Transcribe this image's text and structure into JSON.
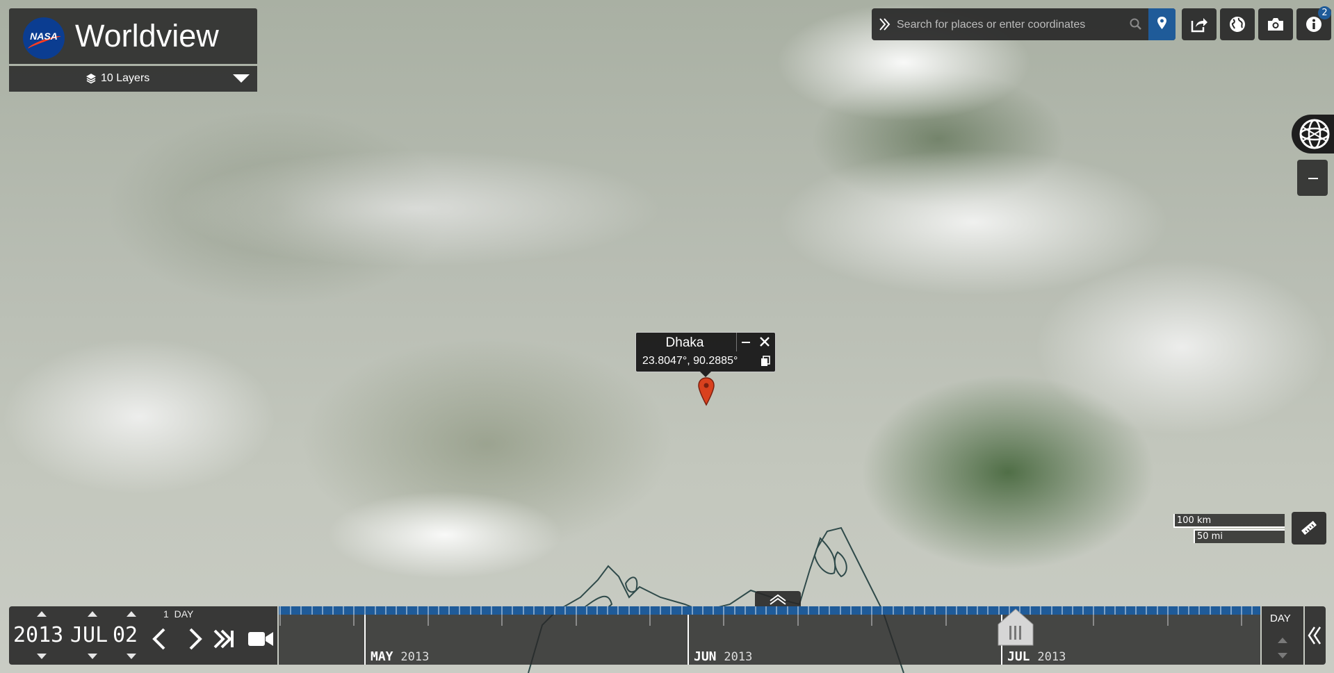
{
  "app": {
    "title": "Worldview",
    "logo_text": "NASA"
  },
  "layers": {
    "label": "10 Layers"
  },
  "search": {
    "placeholder": "Search for places or enter coordinates"
  },
  "toolbar": {
    "info_badge_count": "2"
  },
  "marker": {
    "place_name": "Dhaka",
    "coordinates": "23.8047°, 90.2885°"
  },
  "scale": {
    "km_label": "100 km",
    "mi_label": "50 mi"
  },
  "timeline": {
    "date": {
      "year": "2013",
      "month": "JUL",
      "day": "02"
    },
    "interval": {
      "count": "1",
      "unit": "DAY"
    },
    "zoom_level": "DAY",
    "months": [
      {
        "name": "MAY",
        "year": "2013"
      },
      {
        "name": "JUN",
        "year": "2013"
      },
      {
        "name": "JUL",
        "year": "2013"
      }
    ]
  },
  "colors": {
    "panel_bg": "#282828",
    "accent_blue": "#1f5b99",
    "marker_red": "#d9411e",
    "badge_blue": "#1f5b99"
  },
  "icons": {
    "share": "share-icon",
    "projection": "globe-icon",
    "snapshot": "camera-icon",
    "info": "info-icon",
    "measure": "ruler-icon",
    "location": "location-pin-icon",
    "search": "search-icon",
    "record": "video-camera-icon"
  }
}
